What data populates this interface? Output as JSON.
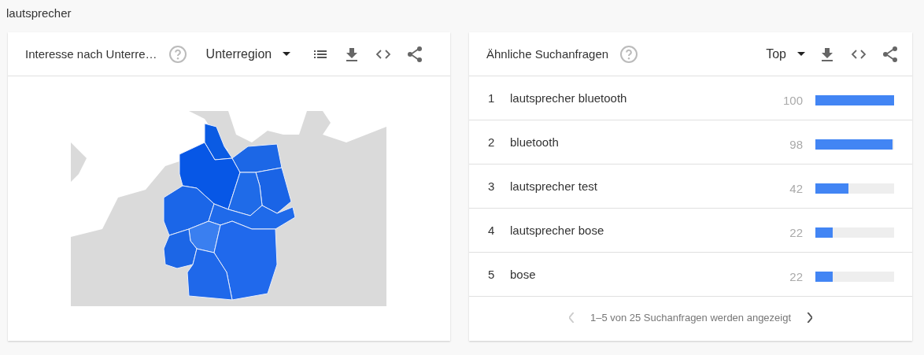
{
  "page_title": "lautsprecher",
  "map_card": {
    "title": "Interesse nach Unterre…",
    "dropdown": "Unterregion"
  },
  "queries_card": {
    "title": "Ähnliche Suchanfragen",
    "dropdown": "Top",
    "rows": [
      {
        "rank": "1",
        "query": "lautsprecher bluetooth",
        "value": "100",
        "level": 1.0
      },
      {
        "rank": "2",
        "query": "bluetooth",
        "value": "98",
        "level": 0.98
      },
      {
        "rank": "3",
        "query": "lautsprecher test",
        "value": "42",
        "level": 0.42
      },
      {
        "rank": "4",
        "query": "lautsprecher bose",
        "value": "22",
        "level": 0.22
      },
      {
        "rank": "5",
        "query": "bose",
        "value": "22",
        "level": 0.22
      }
    ],
    "pagination": {
      "text": "1–5 von 25 Suchanfragen werden angezeigt",
      "previous_disabled": true,
      "next_disabled": false
    }
  }
}
